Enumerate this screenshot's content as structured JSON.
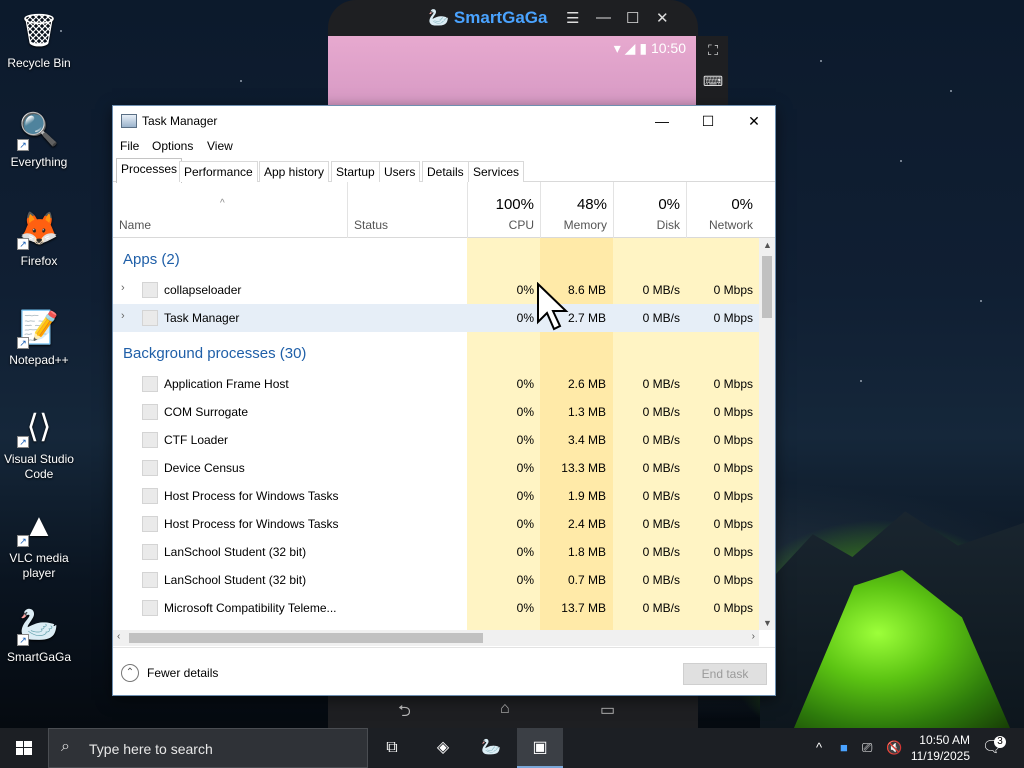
{
  "desktop": {
    "icons": [
      {
        "label": "Recycle Bin",
        "icon": "recycle-bin-icon"
      },
      {
        "label": "Everything",
        "icon": "everything-search-icon"
      },
      {
        "label": "Firefox",
        "icon": "firefox-icon"
      },
      {
        "label": "Notepad++",
        "icon": "notepad-plus-plus-icon"
      },
      {
        "label": "Visual Studio Code",
        "icon": "vscode-icon"
      },
      {
        "label": "VLC media player",
        "icon": "vlc-icon"
      },
      {
        "label": "SmartGaGa",
        "icon": "smartgaga-icon"
      }
    ]
  },
  "emulator": {
    "title": "SmartGaGa",
    "status_time": "10:50"
  },
  "task_manager": {
    "title": "Task Manager",
    "menu": [
      "File",
      "Options",
      "View"
    ],
    "tabs": [
      "Processes",
      "Performance",
      "App history",
      "Startup",
      "Users",
      "Details",
      "Services"
    ],
    "active_tab": "Processes",
    "columns": {
      "name": "Name",
      "status": "Status",
      "cpu": {
        "pct": "100%",
        "label": "CPU"
      },
      "memory": {
        "pct": "48%",
        "label": "Memory"
      },
      "disk": {
        "pct": "0%",
        "label": "Disk"
      },
      "network": {
        "pct": "0%",
        "label": "Network"
      }
    },
    "groups": {
      "apps": "Apps (2)",
      "background": "Background processes (30)"
    },
    "apps": [
      {
        "name": "collapseloader",
        "cpu": "0%",
        "memory": "8.6 MB",
        "disk": "0 MB/s",
        "network": "0 Mbps"
      },
      {
        "name": "Task Manager",
        "cpu": "0%",
        "memory": "2.7 MB",
        "disk": "0 MB/s",
        "network": "0 Mbps"
      }
    ],
    "background": [
      {
        "name": "Application Frame Host",
        "cpu": "0%",
        "memory": "2.6 MB",
        "disk": "0 MB/s",
        "network": "0 Mbps"
      },
      {
        "name": "COM Surrogate",
        "cpu": "0%",
        "memory": "1.3 MB",
        "disk": "0 MB/s",
        "network": "0 Mbps"
      },
      {
        "name": "CTF Loader",
        "cpu": "0%",
        "memory": "3.4 MB",
        "disk": "0 MB/s",
        "network": "0 Mbps"
      },
      {
        "name": "Device Census",
        "cpu": "0%",
        "memory": "13.3 MB",
        "disk": "0 MB/s",
        "network": "0 Mbps"
      },
      {
        "name": "Host Process for Windows Tasks",
        "cpu": "0%",
        "memory": "1.9 MB",
        "disk": "0 MB/s",
        "network": "0 Mbps"
      },
      {
        "name": "Host Process for Windows Tasks",
        "cpu": "0%",
        "memory": "2.4 MB",
        "disk": "0 MB/s",
        "network": "0 Mbps"
      },
      {
        "name": "LanSchool Student (32 bit)",
        "cpu": "0%",
        "memory": "1.8 MB",
        "disk": "0 MB/s",
        "network": "0 Mbps"
      },
      {
        "name": "LanSchool Student (32 bit)",
        "cpu": "0%",
        "memory": "0.7 MB",
        "disk": "0 MB/s",
        "network": "0 Mbps"
      },
      {
        "name": "Microsoft Compatibility Teleme...",
        "cpu": "0%",
        "memory": "13.7 MB",
        "disk": "0 MB/s",
        "network": "0 Mbps"
      }
    ],
    "footer": {
      "fewer_details": "Fewer details",
      "end_task": "End task"
    }
  },
  "taskbar": {
    "search_placeholder": "Type here to search",
    "time": "10:50 AM",
    "date": "11/19/2025",
    "notification_count": "3"
  }
}
